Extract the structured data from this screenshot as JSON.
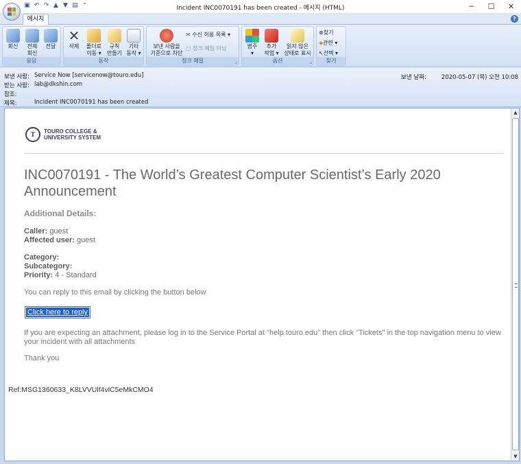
{
  "window": {
    "title": "Incident INC0070191 has been created - 메시지 (HTML)"
  },
  "tabs": [
    {
      "label": "메시지"
    }
  ],
  "ribbon": {
    "respond": {
      "label": "응답",
      "reply": "회신",
      "reply_all_1": "전체",
      "reply_all_2": "회신",
      "forward": "전달"
    },
    "actions": {
      "label": "동작",
      "delete": "삭제",
      "move_1": "폴더로",
      "move_2": "이동 ▾",
      "rules_1": "규칙",
      "rules_2": "만들기",
      "other_1": "기타",
      "other_2": "동작 ▾"
    },
    "junk": {
      "label": "정크 메일",
      "block_1": "보낸 사람을",
      "block_2": "기준으로 차단",
      "safe_list": "수신 허용 목록 ▾",
      "not_junk": "정크 메일 아님"
    },
    "options": {
      "label": "옵션",
      "categorize_1": "범주",
      "categorize_2": "▾",
      "followup_1": "추가",
      "followup_2": "작업 ▾",
      "unread_1": "읽지 않은",
      "unread_2": "상태로 표시"
    },
    "find": {
      "label": "찾기",
      "find": "찾기",
      "related": "관련 ▾",
      "select": "선택 ▾"
    }
  },
  "header": {
    "from_label": "보낸 사람:",
    "from": "Service Now [servicenow@touro.edu]",
    "to_label": "받는 사람:",
    "to": "lab@dkshin.com",
    "cc_label": "참조:",
    "cc": "",
    "subject_label": "제목:",
    "subject": "Incident INC0070191 has been created",
    "sent_label": "보낸 날짜:",
    "sent": "2020-05-07 (목) 오전 10:08"
  },
  "message": {
    "logo_line1": "TOURO COLLEGE &",
    "logo_line2": "UNIVERSITY SYSTEM",
    "title": "INC0070191 - The World’s Greatest Computer Scientist’s Early 2020 Announcement",
    "additional": "Additional Details:",
    "caller_label": "Caller:",
    "caller": " guest",
    "affected_label": "Affected user:",
    "affected": " guest",
    "category_label": "Category:",
    "subcategory_label": "Subcategory:",
    "priority_label": "Priority:",
    "priority": " 4 - Standard",
    "reply_text": "You can reply to this email by clicking the button below",
    "reply_button": "Click here to reply",
    "attach_text": "If you are expecting an attachment, please log in to the Service Portal at \"help.touro.edu\" then click \"Tickets\" in the top navigation menu to view your incident with all attachments",
    "thanks": "Thank you",
    "ref": "Ref:MSG1360633_K8LVVUlf4vlC5eMkCMO4"
  }
}
